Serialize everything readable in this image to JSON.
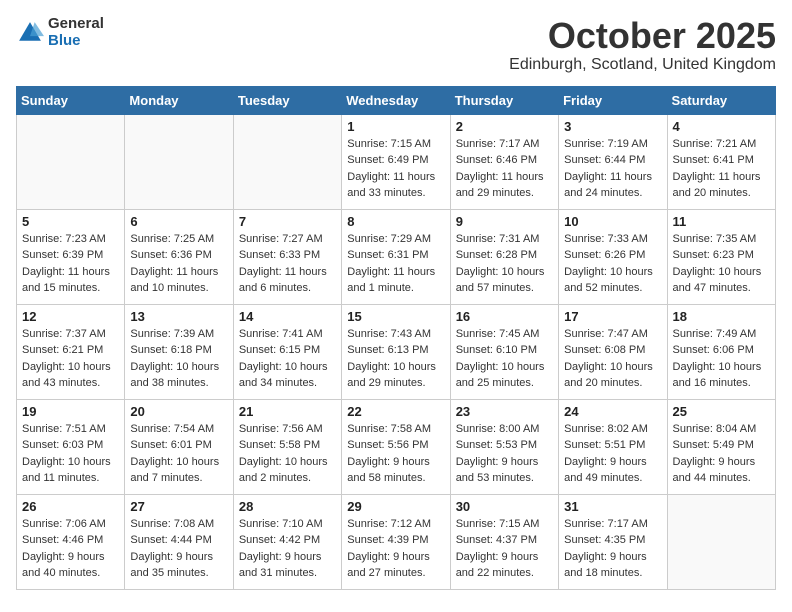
{
  "logo": {
    "general": "General",
    "blue": "Blue"
  },
  "title": {
    "month": "October 2025",
    "location": "Edinburgh, Scotland, United Kingdom"
  },
  "headers": [
    "Sunday",
    "Monday",
    "Tuesday",
    "Wednesday",
    "Thursday",
    "Friday",
    "Saturday"
  ],
  "weeks": [
    [
      {
        "day": "",
        "info": ""
      },
      {
        "day": "",
        "info": ""
      },
      {
        "day": "",
        "info": ""
      },
      {
        "day": "1",
        "info": "Sunrise: 7:15 AM\nSunset: 6:49 PM\nDaylight: 11 hours\nand 33 minutes."
      },
      {
        "day": "2",
        "info": "Sunrise: 7:17 AM\nSunset: 6:46 PM\nDaylight: 11 hours\nand 29 minutes."
      },
      {
        "day": "3",
        "info": "Sunrise: 7:19 AM\nSunset: 6:44 PM\nDaylight: 11 hours\nand 24 minutes."
      },
      {
        "day": "4",
        "info": "Sunrise: 7:21 AM\nSunset: 6:41 PM\nDaylight: 11 hours\nand 20 minutes."
      }
    ],
    [
      {
        "day": "5",
        "info": "Sunrise: 7:23 AM\nSunset: 6:39 PM\nDaylight: 11 hours\nand 15 minutes."
      },
      {
        "day": "6",
        "info": "Sunrise: 7:25 AM\nSunset: 6:36 PM\nDaylight: 11 hours\nand 10 minutes."
      },
      {
        "day": "7",
        "info": "Sunrise: 7:27 AM\nSunset: 6:33 PM\nDaylight: 11 hours\nand 6 minutes."
      },
      {
        "day": "8",
        "info": "Sunrise: 7:29 AM\nSunset: 6:31 PM\nDaylight: 11 hours\nand 1 minute."
      },
      {
        "day": "9",
        "info": "Sunrise: 7:31 AM\nSunset: 6:28 PM\nDaylight: 10 hours\nand 57 minutes."
      },
      {
        "day": "10",
        "info": "Sunrise: 7:33 AM\nSunset: 6:26 PM\nDaylight: 10 hours\nand 52 minutes."
      },
      {
        "day": "11",
        "info": "Sunrise: 7:35 AM\nSunset: 6:23 PM\nDaylight: 10 hours\nand 47 minutes."
      }
    ],
    [
      {
        "day": "12",
        "info": "Sunrise: 7:37 AM\nSunset: 6:21 PM\nDaylight: 10 hours\nand 43 minutes."
      },
      {
        "day": "13",
        "info": "Sunrise: 7:39 AM\nSunset: 6:18 PM\nDaylight: 10 hours\nand 38 minutes."
      },
      {
        "day": "14",
        "info": "Sunrise: 7:41 AM\nSunset: 6:15 PM\nDaylight: 10 hours\nand 34 minutes."
      },
      {
        "day": "15",
        "info": "Sunrise: 7:43 AM\nSunset: 6:13 PM\nDaylight: 10 hours\nand 29 minutes."
      },
      {
        "day": "16",
        "info": "Sunrise: 7:45 AM\nSunset: 6:10 PM\nDaylight: 10 hours\nand 25 minutes."
      },
      {
        "day": "17",
        "info": "Sunrise: 7:47 AM\nSunset: 6:08 PM\nDaylight: 10 hours\nand 20 minutes."
      },
      {
        "day": "18",
        "info": "Sunrise: 7:49 AM\nSunset: 6:06 PM\nDaylight: 10 hours\nand 16 minutes."
      }
    ],
    [
      {
        "day": "19",
        "info": "Sunrise: 7:51 AM\nSunset: 6:03 PM\nDaylight: 10 hours\nand 11 minutes."
      },
      {
        "day": "20",
        "info": "Sunrise: 7:54 AM\nSunset: 6:01 PM\nDaylight: 10 hours\nand 7 minutes."
      },
      {
        "day": "21",
        "info": "Sunrise: 7:56 AM\nSunset: 5:58 PM\nDaylight: 10 hours\nand 2 minutes."
      },
      {
        "day": "22",
        "info": "Sunrise: 7:58 AM\nSunset: 5:56 PM\nDaylight: 9 hours\nand 58 minutes."
      },
      {
        "day": "23",
        "info": "Sunrise: 8:00 AM\nSunset: 5:53 PM\nDaylight: 9 hours\nand 53 minutes."
      },
      {
        "day": "24",
        "info": "Sunrise: 8:02 AM\nSunset: 5:51 PM\nDaylight: 9 hours\nand 49 minutes."
      },
      {
        "day": "25",
        "info": "Sunrise: 8:04 AM\nSunset: 5:49 PM\nDaylight: 9 hours\nand 44 minutes."
      }
    ],
    [
      {
        "day": "26",
        "info": "Sunrise: 7:06 AM\nSunset: 4:46 PM\nDaylight: 9 hours\nand 40 minutes."
      },
      {
        "day": "27",
        "info": "Sunrise: 7:08 AM\nSunset: 4:44 PM\nDaylight: 9 hours\nand 35 minutes."
      },
      {
        "day": "28",
        "info": "Sunrise: 7:10 AM\nSunset: 4:42 PM\nDaylight: 9 hours\nand 31 minutes."
      },
      {
        "day": "29",
        "info": "Sunrise: 7:12 AM\nSunset: 4:39 PM\nDaylight: 9 hours\nand 27 minutes."
      },
      {
        "day": "30",
        "info": "Sunrise: 7:15 AM\nSunset: 4:37 PM\nDaylight: 9 hours\nand 22 minutes."
      },
      {
        "day": "31",
        "info": "Sunrise: 7:17 AM\nSunset: 4:35 PM\nDaylight: 9 hours\nand 18 minutes."
      },
      {
        "day": "",
        "info": ""
      }
    ]
  ]
}
